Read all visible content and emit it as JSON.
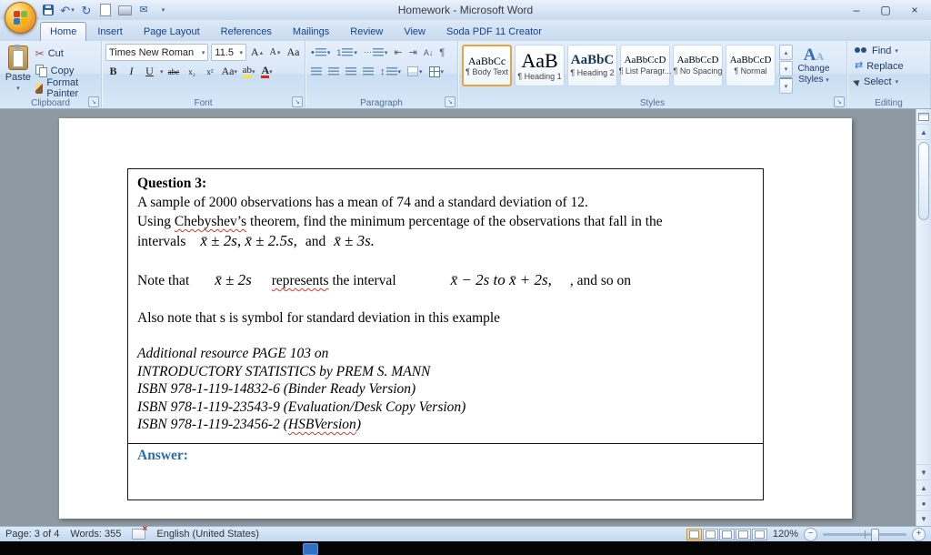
{
  "window": {
    "title": "Homework - Microsoft Word"
  },
  "colors": {
    "answer_blue": "#2a6cb0",
    "style_selected_border": "#e8a33d",
    "taskbar": "#040404"
  },
  "icons": {
    "undo": "↶",
    "redo": "↻",
    "cut": "✂",
    "mail": "✉",
    "dropdown": "▾",
    "scroll_up": "▲",
    "scroll_down": "▼",
    "browse_prev": "▲",
    "browse_next": "▼",
    "browse_ball": "●",
    "minimize": "–",
    "maximize": "▢",
    "close": "×",
    "zoom_out": "−",
    "zoom_in": "+",
    "pilcrow": "¶",
    "indent_dec": "⇤",
    "indent_inc": "⇥",
    "line_spacing": "↕",
    "sort": "A↓",
    "replace_arrows": "⇄",
    "launcher": "↘",
    "bullet": "•",
    "number": "1",
    "multilevel": "⋯"
  },
  "tabs": [
    {
      "label": "Home"
    },
    {
      "label": "Insert"
    },
    {
      "label": "Page Layout"
    },
    {
      "label": "References"
    },
    {
      "label": "Mailings"
    },
    {
      "label": "Review"
    },
    {
      "label": "View"
    },
    {
      "label": "Soda PDF 11 Creator"
    }
  ],
  "ribbon": {
    "clipboard": {
      "caption": "Clipboard",
      "paste": "Paste",
      "cut": "Cut",
      "copy": "Copy",
      "format_painter": "Format Painter"
    },
    "font": {
      "caption": "Font",
      "family": "Times New Roman",
      "size": "11.5",
      "bold": "B",
      "italic": "I",
      "underline": "U",
      "strike": "abc",
      "subscript": "x₂",
      "superscript": "x²",
      "case": "Aa",
      "grow": "A",
      "shrink": "A",
      "clear": "Aa",
      "highlight": "ab",
      "color": "A"
    },
    "paragraph": {
      "caption": "Paragraph"
    },
    "styles": {
      "caption": "Styles",
      "items": [
        {
          "preview": "AaBbCc",
          "label": "¶ Body Text"
        },
        {
          "preview": "AaB",
          "label": "¶ Heading 1"
        },
        {
          "preview": "AaBbC",
          "label": "¶ Heading 2"
        },
        {
          "preview": "AaBbCcD",
          "label": "¶ List Paragr..."
        },
        {
          "preview": "AaBbCcD",
          "label": "¶ No Spacing"
        },
        {
          "preview": "AaBbCcD",
          "label": "¶ Normal"
        }
      ],
      "change1": "Change",
      "change2": "Styles"
    },
    "editing": {
      "caption": "Editing",
      "find": "Find",
      "replace": "Replace",
      "select": "Select"
    }
  },
  "doc": {
    "question_title": "Question 3:",
    "line1": "A sample of 2000 observations has a mean of 74 and a standard deviation of 12.",
    "line2_pre": "Using ",
    "line2_cheb": "Chebyshev’s",
    "line2_post": " theorem, find the minimum percentage of the observations that fall in the",
    "line3_word": "intervals",
    "formula_a": "x̄ ± 2s, x̄ ± 2.5s,",
    "formula_and": "and",
    "formula_b": "x̄ ± 3s.",
    "note_pre": "Note that",
    "note_f1": "x̄ ± 2s",
    "note_mid1": "represents",
    "note_mid2": " the interval",
    "note_f2": "x̄ − 2s to x̄ + 2s,",
    "note_post": ", and so on",
    "also_note": "Also note that s is symbol for standard deviation in this example",
    "res1": "Additional resource PAGE 103 on",
    "res2": "INTRODUCTORY STATISTICS by PREM S. MANN",
    "isbn1": "ISBN 978-1-119-14832-6 (Binder Ready Version)",
    "isbn2": "ISBN 978-1-119-23543-9 (Evaluation/Desk Copy Version)",
    "isbn3_pre": "ISBN 978-1-119-23456-2 (",
    "isbn3_hsb": "HSBVersion",
    "isbn3_post": ")",
    "answer": "Answer:"
  },
  "status": {
    "page": "Page: 3 of 4",
    "words": "Words: 355",
    "language": "English (United States)",
    "zoom": "120%"
  }
}
